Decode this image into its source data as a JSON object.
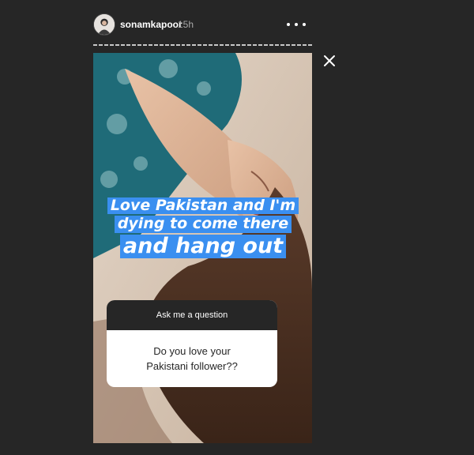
{
  "story": {
    "username": "sonamkapoor",
    "time_ago": "15h",
    "caption_lines": [
      "Love Pakistan and I'm",
      "dying to come there",
      "and hang out"
    ],
    "question_sticker": {
      "header": "Ask me a question",
      "question_lines": [
        "Do you love your",
        "Pakistani follower??"
      ]
    }
  },
  "icons": {
    "more": "more-options-icon",
    "close": "close-icon",
    "avatar": "avatar"
  },
  "colors": {
    "background": "#262626",
    "caption_highlight": "#3a8ff0",
    "sticker_header": "#262626",
    "sticker_body": "#ffffff"
  }
}
